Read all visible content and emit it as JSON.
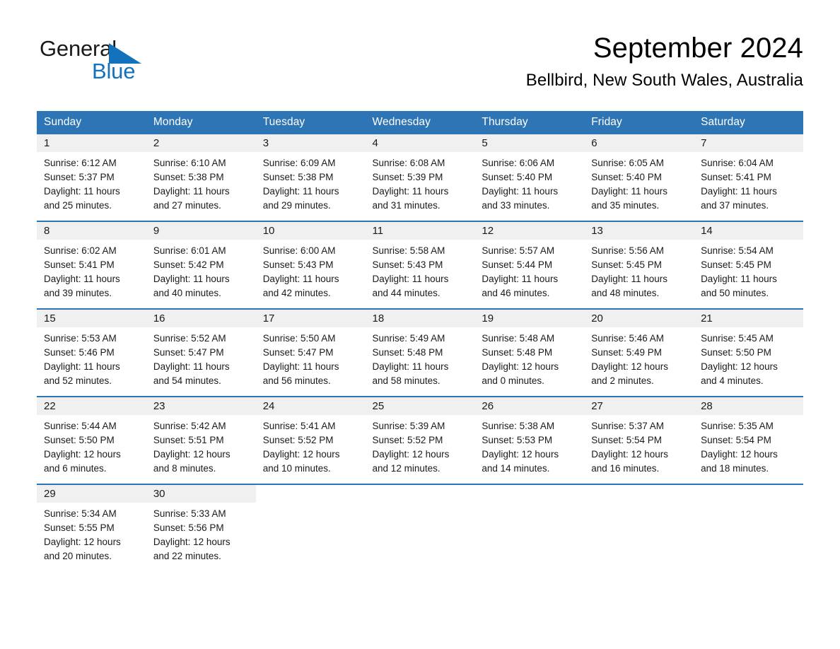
{
  "brand": {
    "name_part1": "General",
    "name_part2": "Blue",
    "triangle_color": "#1272bc"
  },
  "header": {
    "month_title": "September 2024",
    "location": "Bellbird, New South Wales, Australia"
  },
  "theme": {
    "header_blue": "#2e75b6",
    "daynum_strip_gray": "#f0f0f0",
    "text_black": "#1a1a1a"
  },
  "weekdays": [
    "Sunday",
    "Monday",
    "Tuesday",
    "Wednesday",
    "Thursday",
    "Friday",
    "Saturday"
  ],
  "weeks": [
    [
      {
        "day": "1",
        "sunrise": "Sunrise: 6:12 AM",
        "sunset": "Sunset: 5:37 PM",
        "daylight_line1": "Daylight: 11 hours",
        "daylight_line2": "and 25 minutes."
      },
      {
        "day": "2",
        "sunrise": "Sunrise: 6:10 AM",
        "sunset": "Sunset: 5:38 PM",
        "daylight_line1": "Daylight: 11 hours",
        "daylight_line2": "and 27 minutes."
      },
      {
        "day": "3",
        "sunrise": "Sunrise: 6:09 AM",
        "sunset": "Sunset: 5:38 PM",
        "daylight_line1": "Daylight: 11 hours",
        "daylight_line2": "and 29 minutes."
      },
      {
        "day": "4",
        "sunrise": "Sunrise: 6:08 AM",
        "sunset": "Sunset: 5:39 PM",
        "daylight_line1": "Daylight: 11 hours",
        "daylight_line2": "and 31 minutes."
      },
      {
        "day": "5",
        "sunrise": "Sunrise: 6:06 AM",
        "sunset": "Sunset: 5:40 PM",
        "daylight_line1": "Daylight: 11 hours",
        "daylight_line2": "and 33 minutes."
      },
      {
        "day": "6",
        "sunrise": "Sunrise: 6:05 AM",
        "sunset": "Sunset: 5:40 PM",
        "daylight_line1": "Daylight: 11 hours",
        "daylight_line2": "and 35 minutes."
      },
      {
        "day": "7",
        "sunrise": "Sunrise: 6:04 AM",
        "sunset": "Sunset: 5:41 PM",
        "daylight_line1": "Daylight: 11 hours",
        "daylight_line2": "and 37 minutes."
      }
    ],
    [
      {
        "day": "8",
        "sunrise": "Sunrise: 6:02 AM",
        "sunset": "Sunset: 5:41 PM",
        "daylight_line1": "Daylight: 11 hours",
        "daylight_line2": "and 39 minutes."
      },
      {
        "day": "9",
        "sunrise": "Sunrise: 6:01 AM",
        "sunset": "Sunset: 5:42 PM",
        "daylight_line1": "Daylight: 11 hours",
        "daylight_line2": "and 40 minutes."
      },
      {
        "day": "10",
        "sunrise": "Sunrise: 6:00 AM",
        "sunset": "Sunset: 5:43 PM",
        "daylight_line1": "Daylight: 11 hours",
        "daylight_line2": "and 42 minutes."
      },
      {
        "day": "11",
        "sunrise": "Sunrise: 5:58 AM",
        "sunset": "Sunset: 5:43 PM",
        "daylight_line1": "Daylight: 11 hours",
        "daylight_line2": "and 44 minutes."
      },
      {
        "day": "12",
        "sunrise": "Sunrise: 5:57 AM",
        "sunset": "Sunset: 5:44 PM",
        "daylight_line1": "Daylight: 11 hours",
        "daylight_line2": "and 46 minutes."
      },
      {
        "day": "13",
        "sunrise": "Sunrise: 5:56 AM",
        "sunset": "Sunset: 5:45 PM",
        "daylight_line1": "Daylight: 11 hours",
        "daylight_line2": "and 48 minutes."
      },
      {
        "day": "14",
        "sunrise": "Sunrise: 5:54 AM",
        "sunset": "Sunset: 5:45 PM",
        "daylight_line1": "Daylight: 11 hours",
        "daylight_line2": "and 50 minutes."
      }
    ],
    [
      {
        "day": "15",
        "sunrise": "Sunrise: 5:53 AM",
        "sunset": "Sunset: 5:46 PM",
        "daylight_line1": "Daylight: 11 hours",
        "daylight_line2": "and 52 minutes."
      },
      {
        "day": "16",
        "sunrise": "Sunrise: 5:52 AM",
        "sunset": "Sunset: 5:47 PM",
        "daylight_line1": "Daylight: 11 hours",
        "daylight_line2": "and 54 minutes."
      },
      {
        "day": "17",
        "sunrise": "Sunrise: 5:50 AM",
        "sunset": "Sunset: 5:47 PM",
        "daylight_line1": "Daylight: 11 hours",
        "daylight_line2": "and 56 minutes."
      },
      {
        "day": "18",
        "sunrise": "Sunrise: 5:49 AM",
        "sunset": "Sunset: 5:48 PM",
        "daylight_line1": "Daylight: 11 hours",
        "daylight_line2": "and 58 minutes."
      },
      {
        "day": "19",
        "sunrise": "Sunrise: 5:48 AM",
        "sunset": "Sunset: 5:48 PM",
        "daylight_line1": "Daylight: 12 hours",
        "daylight_line2": "and 0 minutes."
      },
      {
        "day": "20",
        "sunrise": "Sunrise: 5:46 AM",
        "sunset": "Sunset: 5:49 PM",
        "daylight_line1": "Daylight: 12 hours",
        "daylight_line2": "and 2 minutes."
      },
      {
        "day": "21",
        "sunrise": "Sunrise: 5:45 AM",
        "sunset": "Sunset: 5:50 PM",
        "daylight_line1": "Daylight: 12 hours",
        "daylight_line2": "and 4 minutes."
      }
    ],
    [
      {
        "day": "22",
        "sunrise": "Sunrise: 5:44 AM",
        "sunset": "Sunset: 5:50 PM",
        "daylight_line1": "Daylight: 12 hours",
        "daylight_line2": "and 6 minutes."
      },
      {
        "day": "23",
        "sunrise": "Sunrise: 5:42 AM",
        "sunset": "Sunset: 5:51 PM",
        "daylight_line1": "Daylight: 12 hours",
        "daylight_line2": "and 8 minutes."
      },
      {
        "day": "24",
        "sunrise": "Sunrise: 5:41 AM",
        "sunset": "Sunset: 5:52 PM",
        "daylight_line1": "Daylight: 12 hours",
        "daylight_line2": "and 10 minutes."
      },
      {
        "day": "25",
        "sunrise": "Sunrise: 5:39 AM",
        "sunset": "Sunset: 5:52 PM",
        "daylight_line1": "Daylight: 12 hours",
        "daylight_line2": "and 12 minutes."
      },
      {
        "day": "26",
        "sunrise": "Sunrise: 5:38 AM",
        "sunset": "Sunset: 5:53 PM",
        "daylight_line1": "Daylight: 12 hours",
        "daylight_line2": "and 14 minutes."
      },
      {
        "day": "27",
        "sunrise": "Sunrise: 5:37 AM",
        "sunset": "Sunset: 5:54 PM",
        "daylight_line1": "Daylight: 12 hours",
        "daylight_line2": "and 16 minutes."
      },
      {
        "day": "28",
        "sunrise": "Sunrise: 5:35 AM",
        "sunset": "Sunset: 5:54 PM",
        "daylight_line1": "Daylight: 12 hours",
        "daylight_line2": "and 18 minutes."
      }
    ],
    [
      {
        "day": "29",
        "sunrise": "Sunrise: 5:34 AM",
        "sunset": "Sunset: 5:55 PM",
        "daylight_line1": "Daylight: 12 hours",
        "daylight_line2": "and 20 minutes."
      },
      {
        "day": "30",
        "sunrise": "Sunrise: 5:33 AM",
        "sunset": "Sunset: 5:56 PM",
        "daylight_line1": "Daylight: 12 hours",
        "daylight_line2": "and 22 minutes."
      },
      {
        "day": "",
        "sunrise": "",
        "sunset": "",
        "daylight_line1": "",
        "daylight_line2": ""
      },
      {
        "day": "",
        "sunrise": "",
        "sunset": "",
        "daylight_line1": "",
        "daylight_line2": ""
      },
      {
        "day": "",
        "sunrise": "",
        "sunset": "",
        "daylight_line1": "",
        "daylight_line2": ""
      },
      {
        "day": "",
        "sunrise": "",
        "sunset": "",
        "daylight_line1": "",
        "daylight_line2": ""
      },
      {
        "day": "",
        "sunrise": "",
        "sunset": "",
        "daylight_line1": "",
        "daylight_line2": ""
      }
    ]
  ]
}
